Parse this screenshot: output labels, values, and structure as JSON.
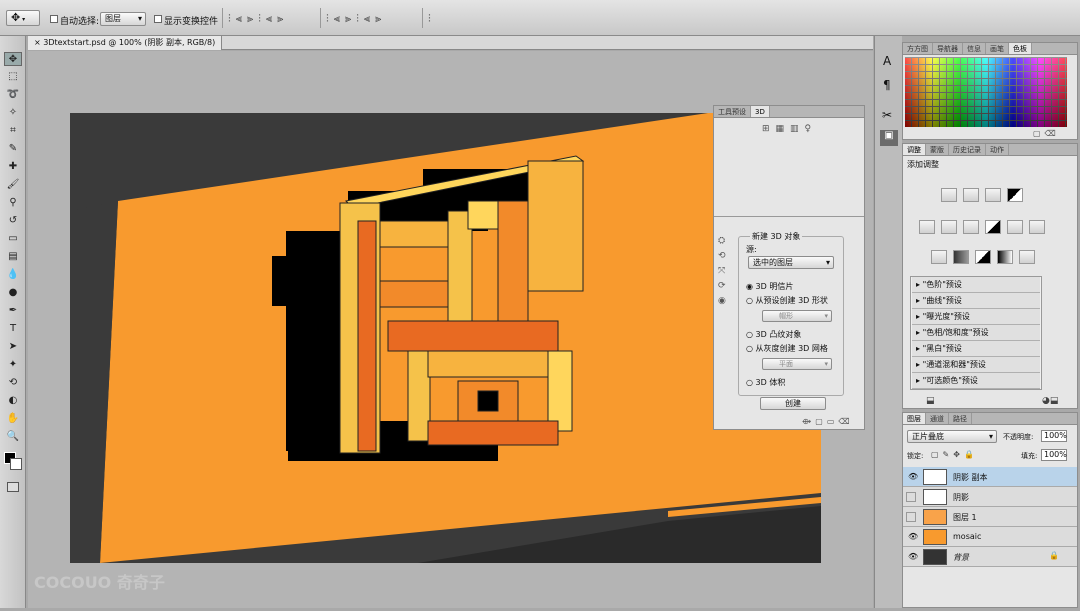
{
  "options_bar": {
    "auto_select_label": "自动选择:",
    "auto_select_value": "图层",
    "show_transform_label": "显示变换控件"
  },
  "document": {
    "tab_title": "3Dtextstart.psd @ 100% (阴影 副本, RGB/8)"
  },
  "right_dock": {
    "top_tabs": [
      "方方图",
      "导航器",
      "信息",
      "画笔",
      "色板"
    ],
    "adj_tabs": [
      "调整",
      "蒙版",
      "历史记录",
      "动作"
    ],
    "adj_title": "添加调整",
    "presets": [
      "\"色阶\"预设",
      "\"曲线\"预设",
      "\"曝光度\"预设",
      "\"色相/饱和度\"预设",
      "\"黑白\"预设",
      "\"通道混和器\"预设",
      "\"可选颜色\"预设"
    ]
  },
  "float_panel": {
    "tabs": [
      "工具预设",
      "3D"
    ],
    "new_3d_label": "新建 3D 对象",
    "source_label": "源:",
    "source_value": "选中的图层",
    "options": [
      {
        "label": "3D 明信片",
        "checked": true
      },
      {
        "label": "从预设创建 3D 形状",
        "checked": false
      },
      {
        "label": "3D 凸纹对象",
        "checked": false
      },
      {
        "label": "从灰度创建 3D 网格",
        "checked": false
      },
      {
        "label": "3D 体积",
        "checked": false
      }
    ],
    "shape_select": "帽形",
    "mesh_select": "平面",
    "create_button": "创建"
  },
  "layers": {
    "tabs": [
      "图层",
      "通道",
      "路径"
    ],
    "blend_mode": "正片叠底",
    "opacity_label": "不透明度:",
    "opacity_value": "100%",
    "lock_label": "锁定:",
    "fill_label": "填充:",
    "fill_value": "100%",
    "items": [
      {
        "name": "阴影 副本",
        "visible": true,
        "selected": true
      },
      {
        "name": "阴影",
        "visible": false,
        "selected": false
      },
      {
        "name": "图层 1",
        "visible": false,
        "selected": false
      },
      {
        "name": "mosaic",
        "visible": true,
        "selected": false
      },
      {
        "name": "背景",
        "visible": true,
        "selected": false
      }
    ]
  },
  "watermark": "COCOUO 奇奇子"
}
